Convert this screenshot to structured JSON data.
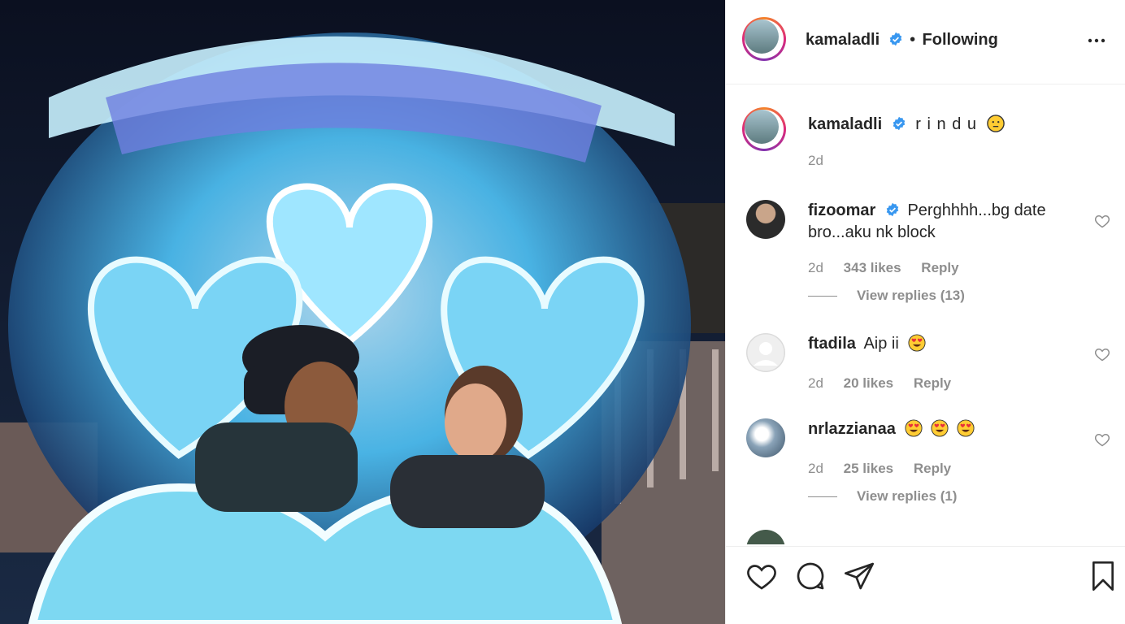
{
  "post": {
    "username": "kamaladli",
    "separator": "•",
    "follow_status": "Following"
  },
  "caption": {
    "username": "kamaladli",
    "text": "r i n d u",
    "time": "2d"
  },
  "comments": [
    {
      "username": "fizoomar",
      "verified": true,
      "text": "Perghhhh...bg date bro...aku nk block",
      "time": "2d",
      "likes": "343 likes",
      "reply": "Reply",
      "view_replies": "View replies (13)"
    },
    {
      "username": "ftadila",
      "verified": false,
      "text": "Aip ii",
      "time": "2d",
      "likes": "20 likes",
      "reply": "Reply"
    },
    {
      "username": "nrlazzianaa",
      "verified": false,
      "text": "",
      "time": "2d",
      "likes": "25 likes",
      "reply": "Reply",
      "view_replies": "View replies (1)"
    }
  ],
  "icons": {
    "like": "heart-icon",
    "comment": "comment-icon",
    "share": "send-icon",
    "save": "bookmark-icon",
    "more": "more-options-icon",
    "verified": "verified-badge-icon",
    "emoji_hushed": "hushed-face-emoji",
    "emoji_heart_eyes": "heart-eyes-emoji"
  },
  "colors": {
    "verified": "#3897f0",
    "text": "#262626",
    "secondary": "#8e8e8e"
  }
}
